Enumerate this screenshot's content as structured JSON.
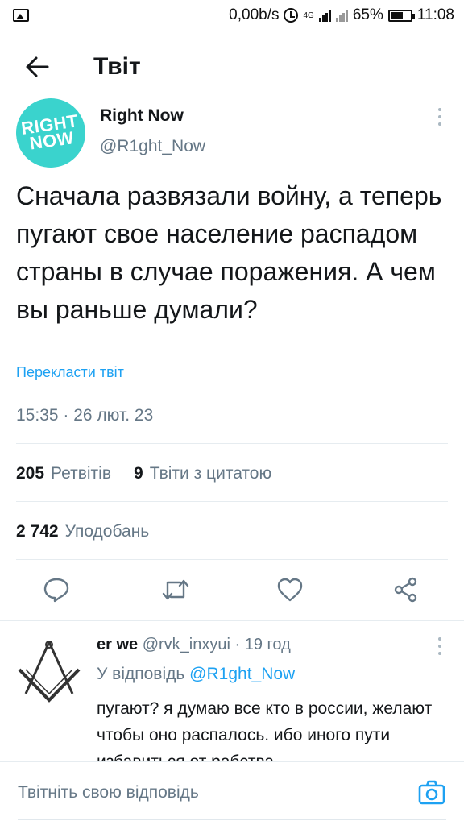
{
  "status_bar": {
    "network_speed": "0,00b/s",
    "network_type": "4G",
    "battery": "65%",
    "time": "11:08",
    "icons": [
      "image-icon",
      "alarm-icon",
      "signal-icon",
      "battery-icon"
    ]
  },
  "header": {
    "title": "Твіт",
    "back_icon": "arrow-left-icon"
  },
  "tweet": {
    "author_name": "Right Now",
    "author_handle": "@R1ght_Now",
    "avatar_text_line1": "RIGHT",
    "avatar_text_line2": "NOW",
    "text": "Сначала развязали войну, а теперь пугают свое население распадом страны в случае поражения. А чем вы раньше думали?",
    "translate_link": "Перекласти твіт",
    "timestamp": "15:35 · 26 лют. 23",
    "retweets_count": "205",
    "retweets_label": "Ретвітів",
    "quotes_count": "9",
    "quotes_label": "Твіти з цитатою",
    "likes_count": "2 742",
    "likes_label": "Уподобань",
    "actions": [
      "reply-icon",
      "retweet-icon",
      "like-icon",
      "share-icon"
    ]
  },
  "reply": {
    "author_name": "er we",
    "author_handle": "@rvk_inxyui",
    "separator": "·",
    "time_ago": "19 год",
    "reply_to_prefix": "У відповідь",
    "reply_to_handle": "@R1ght_Now",
    "text": "пугают? я думаю все кто в россии, желают чтобы оно распалось. ибо иного пути избавиться от рабства"
  },
  "compose": {
    "placeholder": "Твітніть свою відповідь",
    "camera_icon": "camera-icon"
  },
  "colors": {
    "accent": "#1da1f2",
    "secondary_text": "#657786",
    "avatar_bg": "#3ad3cd"
  }
}
